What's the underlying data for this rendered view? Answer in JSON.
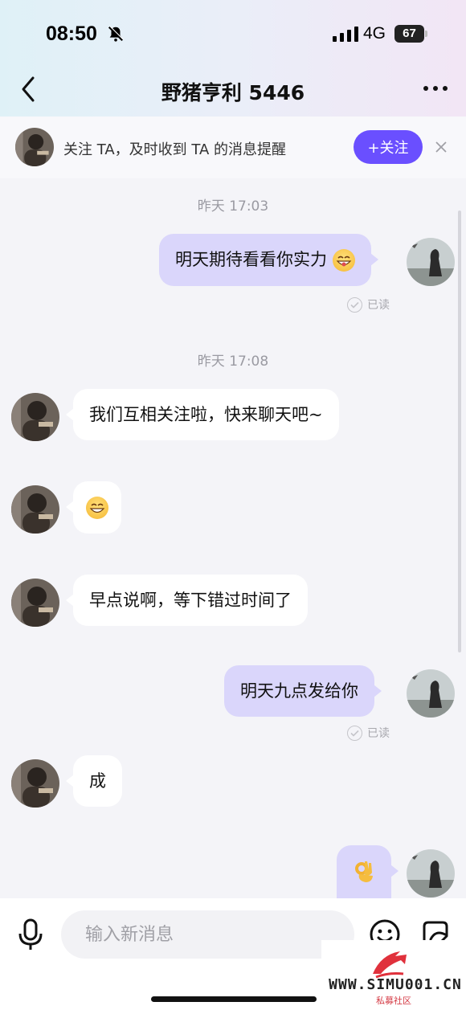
{
  "status_bar": {
    "time": "08:50",
    "network": "4G",
    "battery": "67"
  },
  "nav": {
    "title": "野猪亨利 5446"
  },
  "follow_banner": {
    "text": "关注 TA，及时收到 TA 的消息提醒",
    "button_label": "+关注"
  },
  "messages": [
    {
      "kind": "timestamp",
      "text": "昨天 17:03"
    },
    {
      "kind": "out",
      "text": "明天期待看看你实力",
      "emoji": "grin-emoji",
      "read_label": "已读"
    },
    {
      "kind": "timestamp",
      "text": "昨天 17:08"
    },
    {
      "kind": "in",
      "text": "我们互相关注啦，快来聊天吧~"
    },
    {
      "kind": "in",
      "text": "",
      "emoji": "grin-emoji"
    },
    {
      "kind": "in",
      "text": "早点说啊，等下错过时间了"
    },
    {
      "kind": "out",
      "text": "明天九点发给你",
      "read_label": "已读"
    },
    {
      "kind": "in",
      "text": "成"
    },
    {
      "kind": "out",
      "text": "",
      "emoji": "ok-hand-emoji"
    }
  ],
  "input": {
    "placeholder": "输入新消息"
  },
  "watermark": {
    "text": "WWW.SIMU001.CN",
    "sub": "私募社区"
  },
  "colors": {
    "accent": "#6a4fff",
    "outgoing_bubble": "#dad6fb",
    "incoming_bubble": "#ffffff"
  }
}
